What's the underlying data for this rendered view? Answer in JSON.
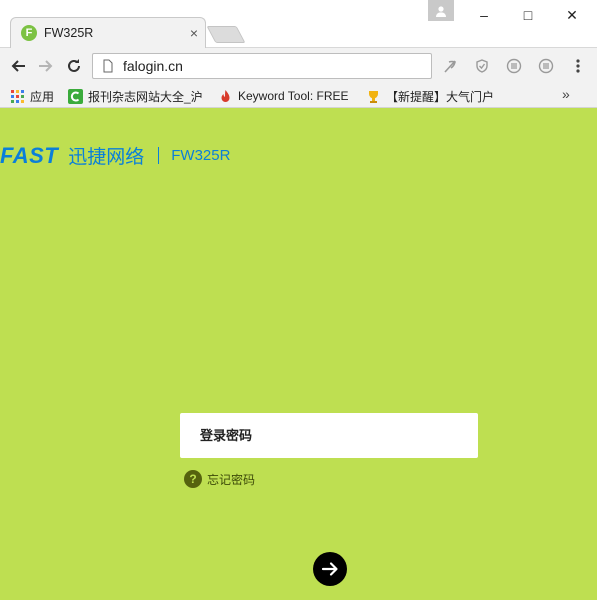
{
  "window": {
    "tab_title": "FW325R",
    "tab_favicon_letter": "F",
    "tab_close": "×",
    "minimize": "–",
    "maximize": "□",
    "close": "✕"
  },
  "toolbar": {
    "url": "falogin.cn"
  },
  "bookmarks": {
    "items": [
      {
        "label": "应用",
        "icon": "apps-grid-icon"
      },
      {
        "label": "报刊杂志网站大全_沪",
        "icon": "c-green-icon"
      },
      {
        "label": "Keyword Tool: FREE",
        "icon": "flame-icon"
      },
      {
        "label": "【新提醒】大气门户",
        "icon": "trophy-icon"
      }
    ],
    "more": "»"
  },
  "page": {
    "brand_logo": "FAST",
    "brand_cn": "迅捷网络",
    "model": "FW325R",
    "password_placeholder": "登录密码",
    "forgot_password": "忘记密码",
    "forgot_icon": "?"
  },
  "colors": {
    "page_bg": "#bedf51",
    "brand_blue": "#0a7fd9",
    "go_button": "#000000"
  }
}
